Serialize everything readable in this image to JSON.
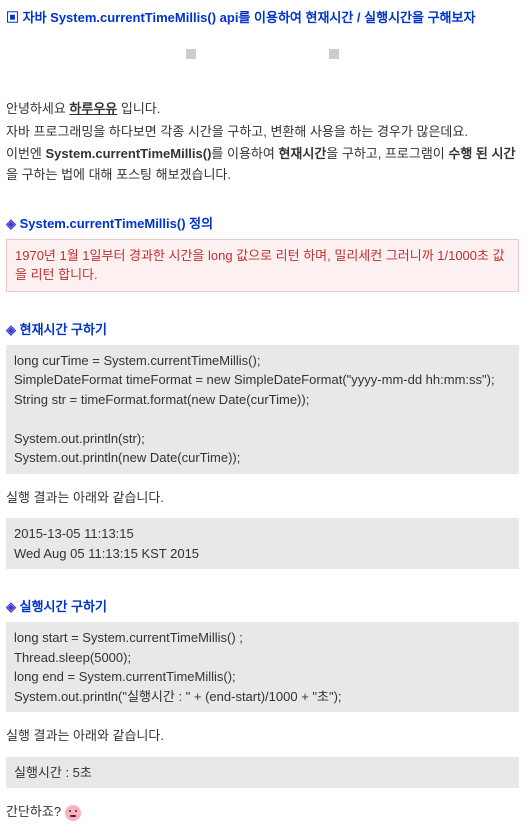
{
  "title": "▣ 자바 System.currentTimeMillis() api를 이용하여 현재시간 / 실행시간을 구해보자",
  "intro": {
    "greeting_pre": "안녕하세요 ",
    "greeting_name": "하루우유",
    "greeting_post": " 입니다.",
    "line2": "자바 프로그래밍을 하다보면 각종 시간을 구하고, 변환해 사용을 하는 경우가 많은데요.",
    "line3_pre": "이번엔 ",
    "line3_bold1": "System.currentTimeMillis()",
    "line3_mid1": "를 이용하여 ",
    "line3_bold2": "현재시간",
    "line3_mid2": "을 구하고, 프로그램이 ",
    "line3_bold3": "수행 된 시간",
    "line3_post": "을 구하는 법에 대해 포스팅 해보겠습니다."
  },
  "section1": {
    "head": "System.currentTimeMillis() 정의",
    "def": "1970년 1월 1일부터 경과한 시간을 long 값으로 리턴 하며, 밀리세컨 그러니까 1/1000초 값을 리턴 합니다."
  },
  "section2": {
    "head": "현재시간 구하기",
    "code": "long curTime = System.currentTimeMillis();\nSimpleDateFormat timeFormat = new SimpleDateFormat(\"yyyy-mm-dd hh:mm:ss\");\nString str = timeFormat.format(new Date(curTime));\n\nSystem.out.println(str);\nSystem.out.println(new Date(curTime));",
    "result_label": "실행 결과는 아래와 같습니다.",
    "result": "2015-13-05 11:13:15\nWed Aug 05 11:13:15 KST 2015"
  },
  "section3": {
    "head": "실행시간 구하기",
    "code": "long start = System.currentTimeMillis() ;\nThread.sleep(5000);\nlong end = System.currentTimeMillis();\nSystem.out.println(\"실행시간 : \" + (end-start)/1000 + \"초\");",
    "result_label": "실행 결과는 아래와 같습니다.",
    "result": "실행시간 : 5초"
  },
  "simple_q": "간단하죠? "
}
